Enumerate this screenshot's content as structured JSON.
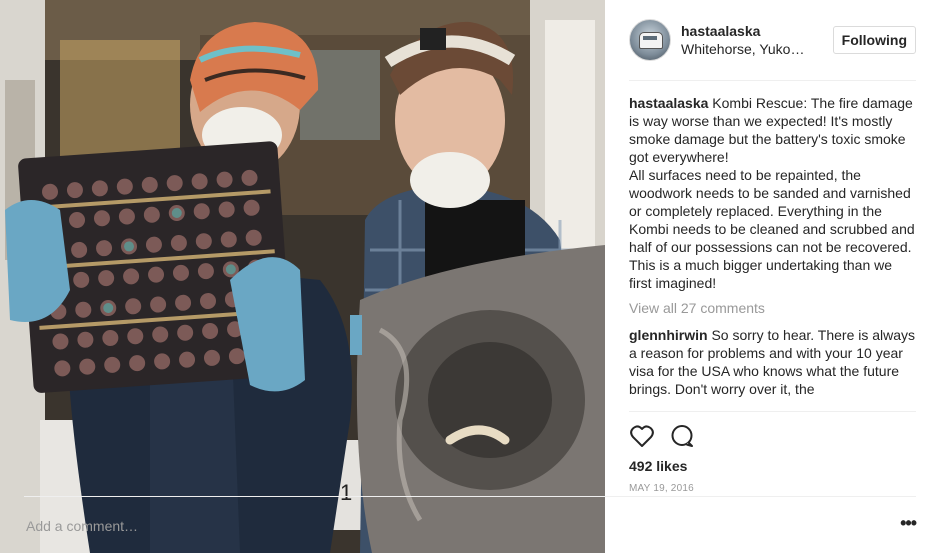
{
  "post": {
    "username": "hastaalaska",
    "location": "Whitehorse, Yuko…",
    "follow_label": "Following",
    "caption": {
      "author": "hastaalaska",
      "text": "Kombi Rescue: The fire damage is way worse than we expected! It's mostly smoke damage but the battery's toxic smoke got everywhere!\nAll surfaces need to be repainted, the woodwork needs to be sanded and varnished or completely replaced. Everything in the Kombi needs to be cleaned and scrubbed and half of our possessions can not be recovered. This is a much bigger undertaking than we first imagined!"
    },
    "view_all_comments": "View all 27 comments",
    "comment": {
      "author": "glennhirwin",
      "text": "So sorry to hear. There is always a reason for problems and with your 10 year visa for the USA who knows what the future brings. Don't worry over it, the"
    },
    "likes": "492 likes",
    "date": "MAY 19, 2016",
    "add_comment_placeholder": "Add a comment…",
    "more_label": "•••",
    "photo_sign": "1"
  },
  "icons": {
    "like": "heart-icon",
    "comment": "comment-bubble-icon",
    "more": "more-options-icon"
  },
  "colors": {
    "text": "#262626",
    "muted": "#999999",
    "border": "#efefef",
    "glove": "#6aa7c4"
  }
}
